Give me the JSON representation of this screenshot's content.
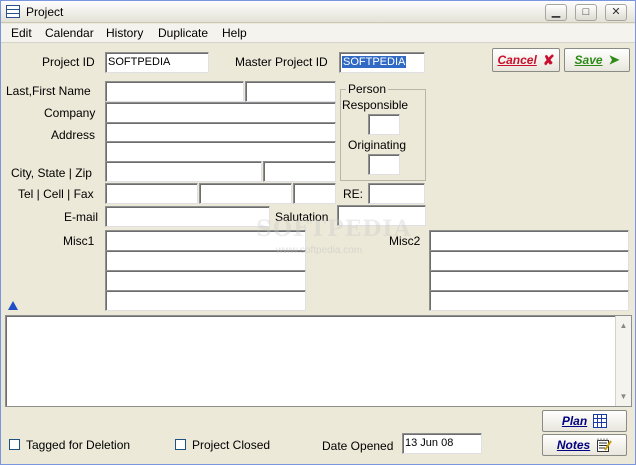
{
  "window": {
    "title": "Project",
    "min_glyph": "▁",
    "max_glyph": "□",
    "close_glyph": "✕"
  },
  "menu": {
    "items": [
      "Edit",
      "Calendar",
      "History",
      "Duplicate",
      "Help"
    ]
  },
  "form": {
    "project_id": {
      "label": "Project ID",
      "value": "SOFTPEDIA"
    },
    "master_project_id": {
      "label": "Master Project ID",
      "value": "SOFTPEDIA"
    },
    "name_label": "Last,First Name",
    "company_label": "Company",
    "address_label": "Address",
    "city_label": "City, State | Zip",
    "tel_label": "Tel | Cell | Fax",
    "re_label": "RE:",
    "email_label": "E-mail",
    "salutation_label": "Salutation",
    "misc1_label": "Misc1",
    "misc2_label": "Misc2",
    "person_group": {
      "title": "Person",
      "responsible_label": "Responsible",
      "originating_label": "Originating"
    }
  },
  "buttons": {
    "cancel": "Cancel",
    "cancel_glyph": "✘",
    "save": "Save",
    "save_glyph": "➤",
    "plan": "Plan",
    "notes": "Notes"
  },
  "bottom": {
    "tagged_label": "Tagged for Deletion",
    "closed_label": "Project Closed",
    "date_opened_label": "Date Opened",
    "date_opened_value": "13 Jun 08"
  },
  "watermark": {
    "text": "SOFTPEDIA",
    "sub": "www.softpedia.com"
  },
  "colors": {
    "cancel": "#c8102e",
    "save": "#2e8b1a",
    "accent": "#000080",
    "selection": "#316ac5"
  },
  "icons": [
    "app-icon",
    "minimize-icon",
    "maximize-icon",
    "close-icon",
    "cancel-x-icon",
    "save-arrow-icon",
    "plan-grid-icon",
    "notes-pad-icon",
    "scroll-up-icon",
    "scroll-down-icon",
    "expand-triangle-icon"
  ]
}
